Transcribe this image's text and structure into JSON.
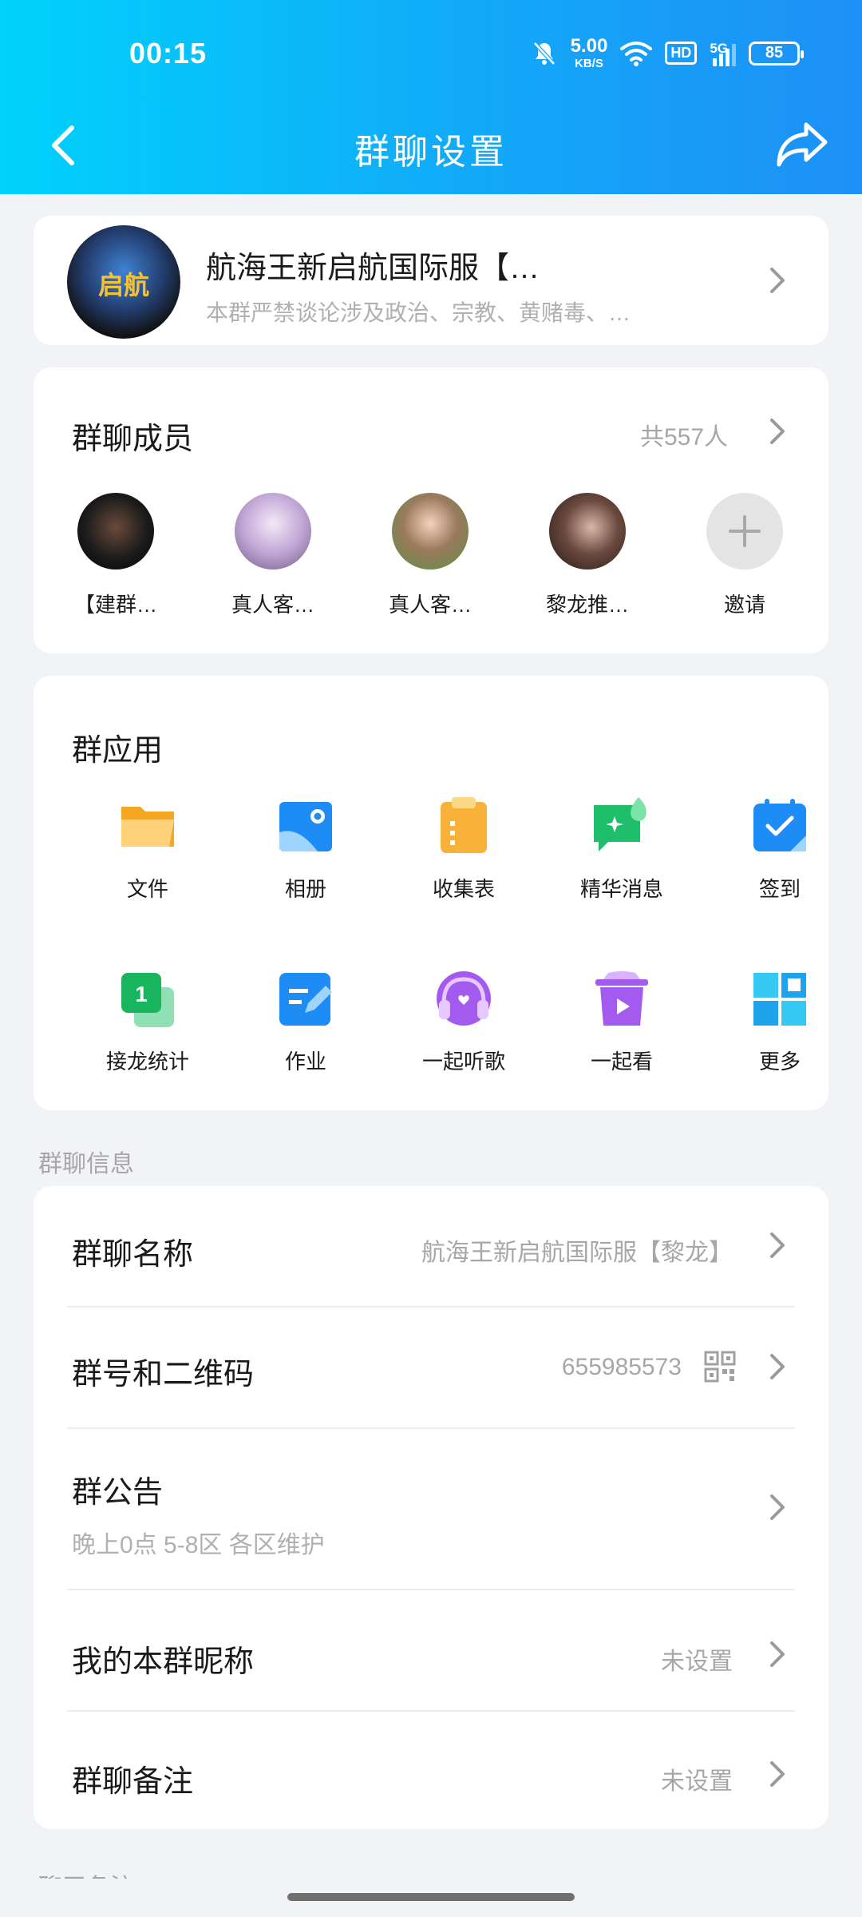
{
  "status_bar": {
    "time": "00:15",
    "speed_value": "5.00",
    "speed_unit": "KB/S",
    "hd": "HD",
    "network": "5G",
    "battery": "85"
  },
  "header": {
    "title": "群聊设置"
  },
  "group": {
    "name": "航海王新启航国际服【…",
    "description": "本群严禁谈论涉及政治、宗教、黄赌毒、…",
    "avatar_text": "启航"
  },
  "members": {
    "title": "群聊成员",
    "count": "共557人",
    "list": [
      {
        "name": "【建群…",
        "color": "#101010"
      },
      {
        "name": "真人客…",
        "color": "#b59ccd"
      },
      {
        "name": "真人客…",
        "color": "#8d6b4f"
      },
      {
        "name": "黎龙推…",
        "color": "#3c2b26"
      }
    ],
    "invite_label": "邀请"
  },
  "apps": {
    "title": "群应用",
    "items": [
      {
        "label": "文件",
        "icon": "folder-icon"
      },
      {
        "label": "相册",
        "icon": "photo-album-icon"
      },
      {
        "label": "收集表",
        "icon": "clipboard-icon"
      },
      {
        "label": "精华消息",
        "icon": "highlight-message-icon"
      },
      {
        "label": "签到",
        "icon": "calendar-check-icon"
      },
      {
        "label": "接龙统计",
        "icon": "chain-count-icon"
      },
      {
        "label": "作业",
        "icon": "homework-icon"
      },
      {
        "label": "一起听歌",
        "icon": "headphones-icon"
      },
      {
        "label": "一起看",
        "icon": "play-tv-icon"
      },
      {
        "label": "更多",
        "icon": "grid-more-icon"
      }
    ]
  },
  "info": {
    "section_title": "群聊信息",
    "group_name_label": "群聊名称",
    "group_name_value": "航海王新启航国际服【黎龙】",
    "group_id_label": "群号和二维码",
    "group_id_value": "655985573",
    "announcement_label": "群公告",
    "announcement_value": "晚上0点 5-8区 各区维护",
    "my_nickname_label": "我的本群昵称",
    "my_nickname_value": "未设置",
    "remark_label": "群聊备注",
    "remark_value": "未设置"
  },
  "next_section_title": "聊天备注"
}
